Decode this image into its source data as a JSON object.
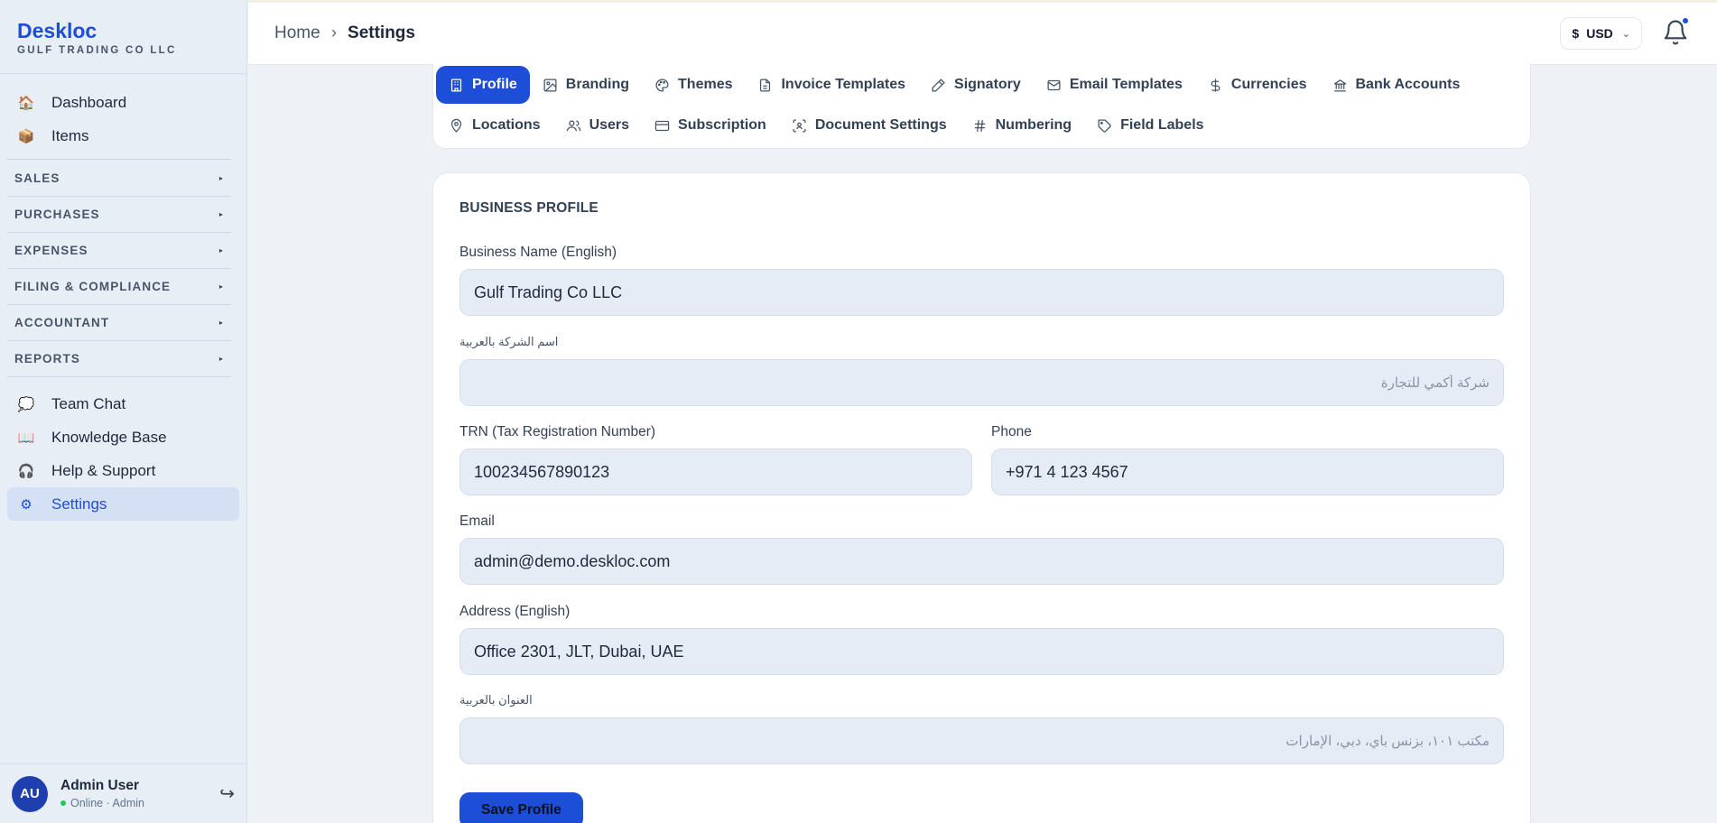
{
  "brand": {
    "name": "Deskloc",
    "company": "GULF TRADING CO LLC"
  },
  "sidebar": {
    "top_items": [
      {
        "label": "Dashboard",
        "icon": "house-icon"
      },
      {
        "label": "Items",
        "icon": "box-icon"
      }
    ],
    "sections": [
      {
        "label": "SALES"
      },
      {
        "label": "PURCHASES"
      },
      {
        "label": "EXPENSES"
      },
      {
        "label": "FILING & COMPLIANCE"
      },
      {
        "label": "ACCOUNTANT"
      },
      {
        "label": "REPORTS"
      }
    ],
    "bottom_items": [
      {
        "label": "Team Chat",
        "icon": "chat-bubble-icon"
      },
      {
        "label": "Knowledge Base",
        "icon": "book-icon"
      },
      {
        "label": "Help & Support",
        "icon": "headphones-icon"
      },
      {
        "label": "Settings",
        "icon": "gear-icon",
        "active": true
      }
    ]
  },
  "user": {
    "initials": "AU",
    "name": "Admin User",
    "status": "Online · Admin"
  },
  "header": {
    "breadcrumb_home": "Home",
    "breadcrumb_separator": "›",
    "breadcrumb_current": "Settings",
    "currency_symbol": "$",
    "currency": "USD",
    "notification_dot_color": "#1d4ed8"
  },
  "tabs": {
    "row1": [
      {
        "label": "Profile",
        "icon": "building-icon",
        "active": true
      },
      {
        "label": "Branding",
        "icon": "image-icon"
      },
      {
        "label": "Themes",
        "icon": "palette-icon"
      },
      {
        "label": "Invoice Templates",
        "icon": "document-icon"
      },
      {
        "label": "Signatory",
        "icon": "pen-icon"
      },
      {
        "label": "Email Templates",
        "icon": "mail-icon"
      },
      {
        "label": "Currencies",
        "icon": "dollar-icon"
      },
      {
        "label": "Bank Accounts",
        "icon": "bank-icon"
      }
    ],
    "row2": [
      {
        "label": "Locations",
        "icon": "map-pin-icon"
      },
      {
        "label": "Users",
        "icon": "users-icon"
      },
      {
        "label": "Subscription",
        "icon": "credit-card-icon"
      },
      {
        "label": "Document Settings",
        "icon": "scan-icon"
      },
      {
        "label": "Numbering",
        "icon": "hash-icon"
      },
      {
        "label": "Field Labels",
        "icon": "tag-icon"
      }
    ]
  },
  "form": {
    "title": "BUSINESS PROFILE",
    "business_name_label": "Business Name (English)",
    "business_name_value": "Gulf Trading Co LLC",
    "business_name_ar_label": "اسم الشركة بالعربية",
    "business_name_ar_placeholder": "شركة أكمي للتجارة",
    "trn_label": "TRN (Tax Registration Number)",
    "trn_value": "100234567890123",
    "phone_label": "Phone",
    "phone_value": "+971 4 123 4567",
    "email_label": "Email",
    "email_value": "admin@demo.deskloc.com",
    "address_label": "Address (English)",
    "address_value": "Office 2301, JLT, Dubai, UAE",
    "address_ar_label": "العنوان بالعربية",
    "address_ar_placeholder": "مكتب ١٠١، بزنس باي، دبي، الإمارات",
    "save_label": "Save Profile"
  }
}
